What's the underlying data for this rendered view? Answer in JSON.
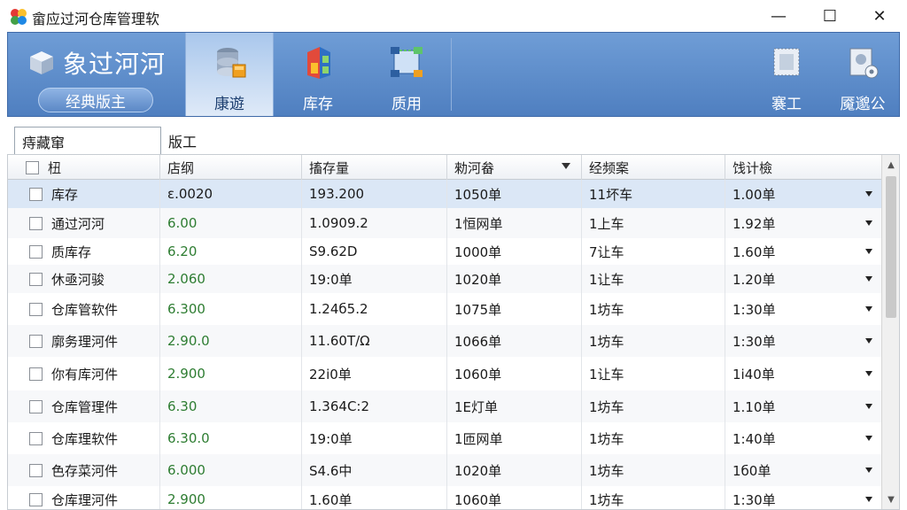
{
  "window": {
    "title": "畲应过河仓库管理软",
    "minimize": "—",
    "maximize": "☐",
    "close": "✕"
  },
  "ribbon": {
    "brand_name": "象过河河",
    "edition_label": "经典版主",
    "buttons": [
      {
        "label": "康遊",
        "icon": "database-icon",
        "active": true
      },
      {
        "label": "库存",
        "icon": "warehouse-icon",
        "active": false
      },
      {
        "label": "质用",
        "icon": "network-icon",
        "active": false
      }
    ],
    "right_buttons": [
      {
        "label": "褰工",
        "icon": "stamp-icon"
      },
      {
        "label": "魇邈公",
        "icon": "user-settings-icon"
      }
    ]
  },
  "tabs": [
    {
      "label": "痔藏窜",
      "active": true
    },
    {
      "label": "版工",
      "active": false
    }
  ],
  "grid": {
    "columns": [
      "杻",
      "店纲",
      "搐存量",
      "勑河畚",
      "经频案",
      "饯计檢"
    ],
    "rows": [
      [
        "库存",
        "ε.0020",
        "193.200",
        "1050单",
        "11坏车",
        "1.00单"
      ],
      [
        "通过河河",
        "6.00",
        "1.0909.2",
        "1恒网单",
        "1上车",
        "1.92单"
      ],
      [
        "质库存",
        "6.20",
        "S9.62D",
        "1000单",
        "7让车",
        "1.60单"
      ],
      [
        "休亟河骏",
        "2.060",
        "19:0单",
        "1020单",
        "1让车",
        "1.20单"
      ],
      [
        "仓库管软件",
        "6.300",
        "1.24б5.2",
        "1075单",
        "1坊车",
        "1:30单"
      ],
      [
        "廓务理河件",
        "2.90.0",
        "11.60T/Ω",
        "1066单",
        "1坊车",
        "1:30单"
      ],
      [
        "你有库河件",
        "2.900",
        "22i0单",
        "1060单",
        "1让车",
        "1i40单"
      ],
      [
        "仓库管理件",
        "6.30",
        "1.364C:2",
        "1Ε灯单",
        "1坊车",
        "1.10单"
      ],
      [
        "仓库理软件",
        "6.30.0",
        "19:0单",
        "1匝网单",
        "1坊车",
        "1:40单"
      ],
      [
        "色存菜河件",
        "6.000",
        "S4.6中",
        "1020单",
        "1坊车",
        "1б0单"
      ],
      [
        "仓库理河件",
        "2.900",
        "1.60单",
        "1060单",
        "1坊车",
        "1:30单"
      ]
    ],
    "green_column": 1
  },
  "colors": {
    "ribbon_top": "#6f9dd6",
    "ribbon_bottom": "#4f7fc0",
    "selected_row": "#dbe7f6",
    "value_green": "#2e7d32"
  }
}
